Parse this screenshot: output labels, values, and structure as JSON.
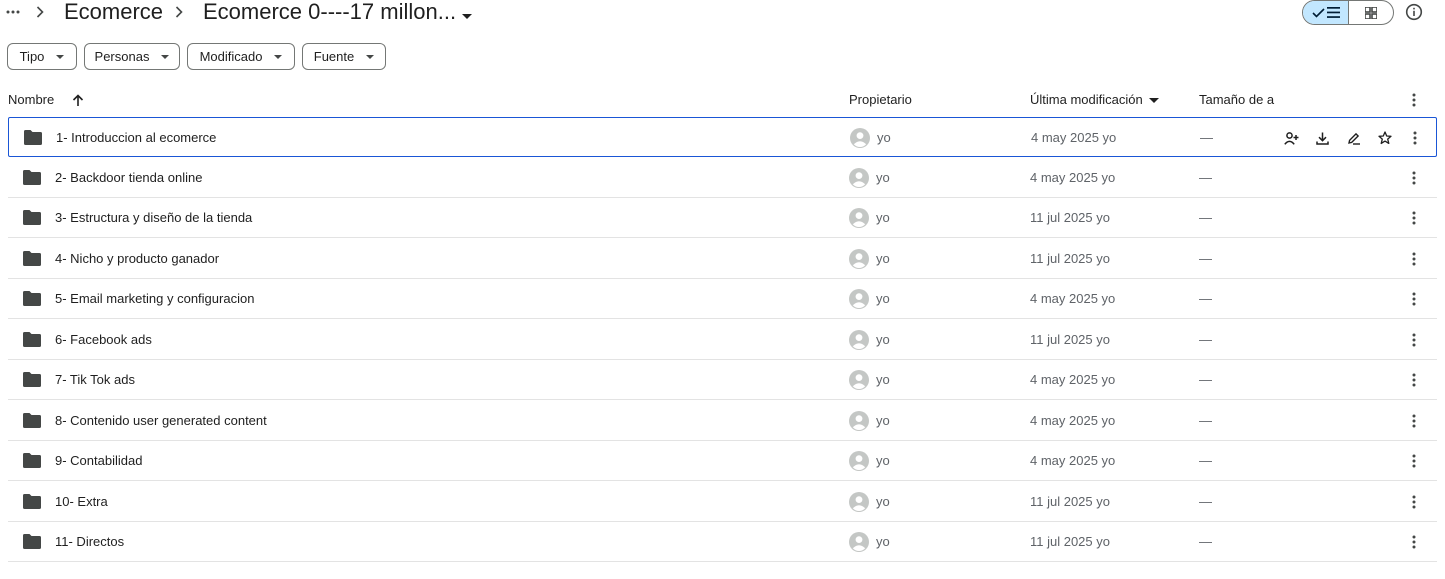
{
  "breadcrumb": {
    "parent": "Ecomerce",
    "current": "Ecomerce 0----17 millon..."
  },
  "filters": [
    {
      "label": "Tipo"
    },
    {
      "label": "Personas"
    },
    {
      "label": "Modificado"
    },
    {
      "label": "Fuente"
    }
  ],
  "columns": {
    "name": "Nombre",
    "owner": "Propietario",
    "modified": "Última modificación",
    "size": "Tamaño de a"
  },
  "colors": {
    "accent": "#1a56d6",
    "toggle_active_bg": "#c2e7ff",
    "divider": "#e3e3e3",
    "folder": "#444746"
  },
  "rows": [
    {
      "name": "1- Introduccion al ecomerce",
      "owner": "yo",
      "modified": "4 may 2025 yo",
      "size": "—",
      "selected": true
    },
    {
      "name": "2- Backdoor tienda online",
      "owner": "yo",
      "modified": "4 may 2025 yo",
      "size": "—"
    },
    {
      "name": "3- Estructura y diseño de la tienda",
      "owner": "yo",
      "modified": "11 jul 2025 yo",
      "size": "—"
    },
    {
      "name": "4- Nicho y producto ganador",
      "owner": "yo",
      "modified": "11 jul 2025 yo",
      "size": "—"
    },
    {
      "name": "5- Email marketing y configuracion",
      "owner": "yo",
      "modified": "4 may 2025 yo",
      "size": "—"
    },
    {
      "name": "6- Facebook ads",
      "owner": "yo",
      "modified": "11 jul 2025 yo",
      "size": "—"
    },
    {
      "name": "7- Tik Tok ads",
      "owner": "yo",
      "modified": "4 may 2025 yo",
      "size": "—"
    },
    {
      "name": "8- Contenido user generated content",
      "owner": "yo",
      "modified": "4 may 2025 yo",
      "size": "—"
    },
    {
      "name": "9- Contabilidad",
      "owner": "yo",
      "modified": "4 may 2025 yo",
      "size": "—"
    },
    {
      "name": "10- Extra",
      "owner": "yo",
      "modified": "11 jul 2025 yo",
      "size": "—"
    },
    {
      "name": "11- Directos",
      "owner": "yo",
      "modified": "11 jul 2025 yo",
      "size": "—"
    }
  ]
}
